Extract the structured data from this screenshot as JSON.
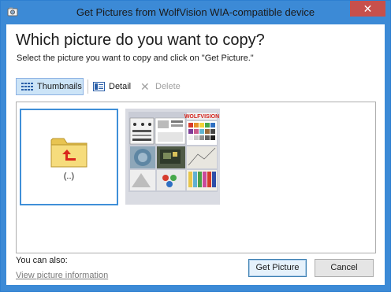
{
  "window": {
    "title": "Get Pictures from WolfVision WIA-compatible device",
    "close_glyph": "✕"
  },
  "header": {
    "heading": "Which picture do you want to copy?",
    "subtext": "Select the picture you want to copy and click on \"Get Picture.\""
  },
  "toolbar": {
    "thumbnails_label": "Thumbnails",
    "detail_label": "Detail",
    "delete_label": "Delete"
  },
  "items": [
    {
      "label": "(..)",
      "type": "parent-folder"
    },
    {
      "label": "",
      "type": "photo"
    }
  ],
  "footer": {
    "also_label": "You can also:",
    "link_label": "View picture information",
    "get_picture_label": "Get Picture",
    "cancel_label": "Cancel"
  },
  "colors": {
    "titlebar": "#3c8ad6",
    "close": "#c7504c",
    "selection_border": "#3f8fd8",
    "toolbar_active": "#cce4f7"
  }
}
